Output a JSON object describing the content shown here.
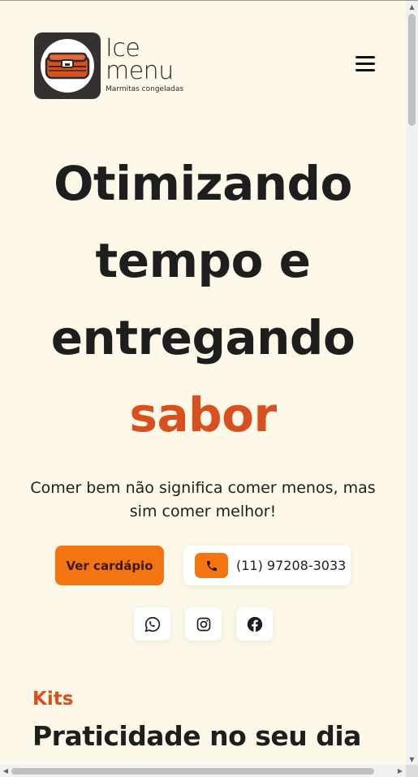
{
  "brand": {
    "name_line1": "Ice",
    "name_line2": "menu",
    "tagline": "Marmitas congeladas",
    "badge_color": "#353130",
    "lunchbox_color": "#d9501e"
  },
  "header": {
    "menu_icon": "hamburger-menu-icon"
  },
  "hero": {
    "title_line1": "Otimizando",
    "title_line2": "tempo e",
    "title_line3": "entregando",
    "title_accent": "sabor",
    "subtitle": "Comer bem não significa comer menos, mas sim comer melhor!",
    "primary_button": "Ver cardápio",
    "phone": "(11) 97208-3033",
    "phone_icon": "phone-icon",
    "accent_color": "#d9501e",
    "button_color": "#f57412"
  },
  "social": [
    {
      "name": "whatsapp",
      "icon": "whatsapp-icon"
    },
    {
      "name": "instagram",
      "icon": "instagram-icon"
    },
    {
      "name": "facebook",
      "icon": "facebook-icon"
    }
  ],
  "section": {
    "kicker": "Kits",
    "title": "Praticidade no seu dia"
  }
}
